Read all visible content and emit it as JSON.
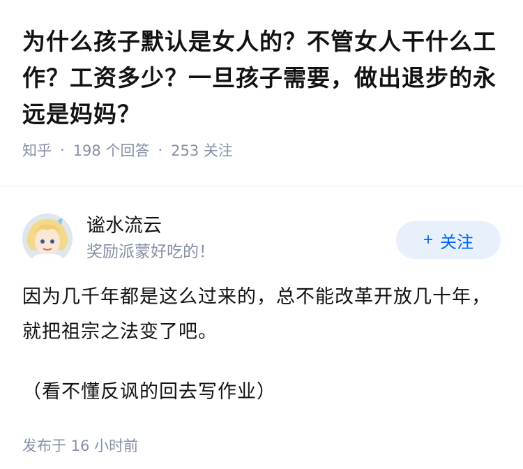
{
  "question": {
    "title": "为什么孩子默认是女人的？不管女人干什么工作？工资多少？一旦孩子需要，做出退步的永远是妈妈？",
    "source": "知乎",
    "separator": "·",
    "answer_count": "198 个回答",
    "follow_count": "253 关注"
  },
  "answer": {
    "author_name": "谧水流云",
    "author_signature": "奖励派蒙好吃的！",
    "follow_plus": "+",
    "follow_label": "关注",
    "paragraphs": [
      "因为几千年都是这么过来的，总不能改革开放几十年，就把祖宗之法变了吧。",
      "（看不懂反讽的回去写作业）"
    ],
    "published": "发布于 16 小时前"
  },
  "icons": {
    "avatar": "anime-character-avatar"
  },
  "colors": {
    "text": "#121212",
    "meta": "#8590a6",
    "accent": "#0066ff",
    "follow_bg": "#e8f0fb"
  }
}
